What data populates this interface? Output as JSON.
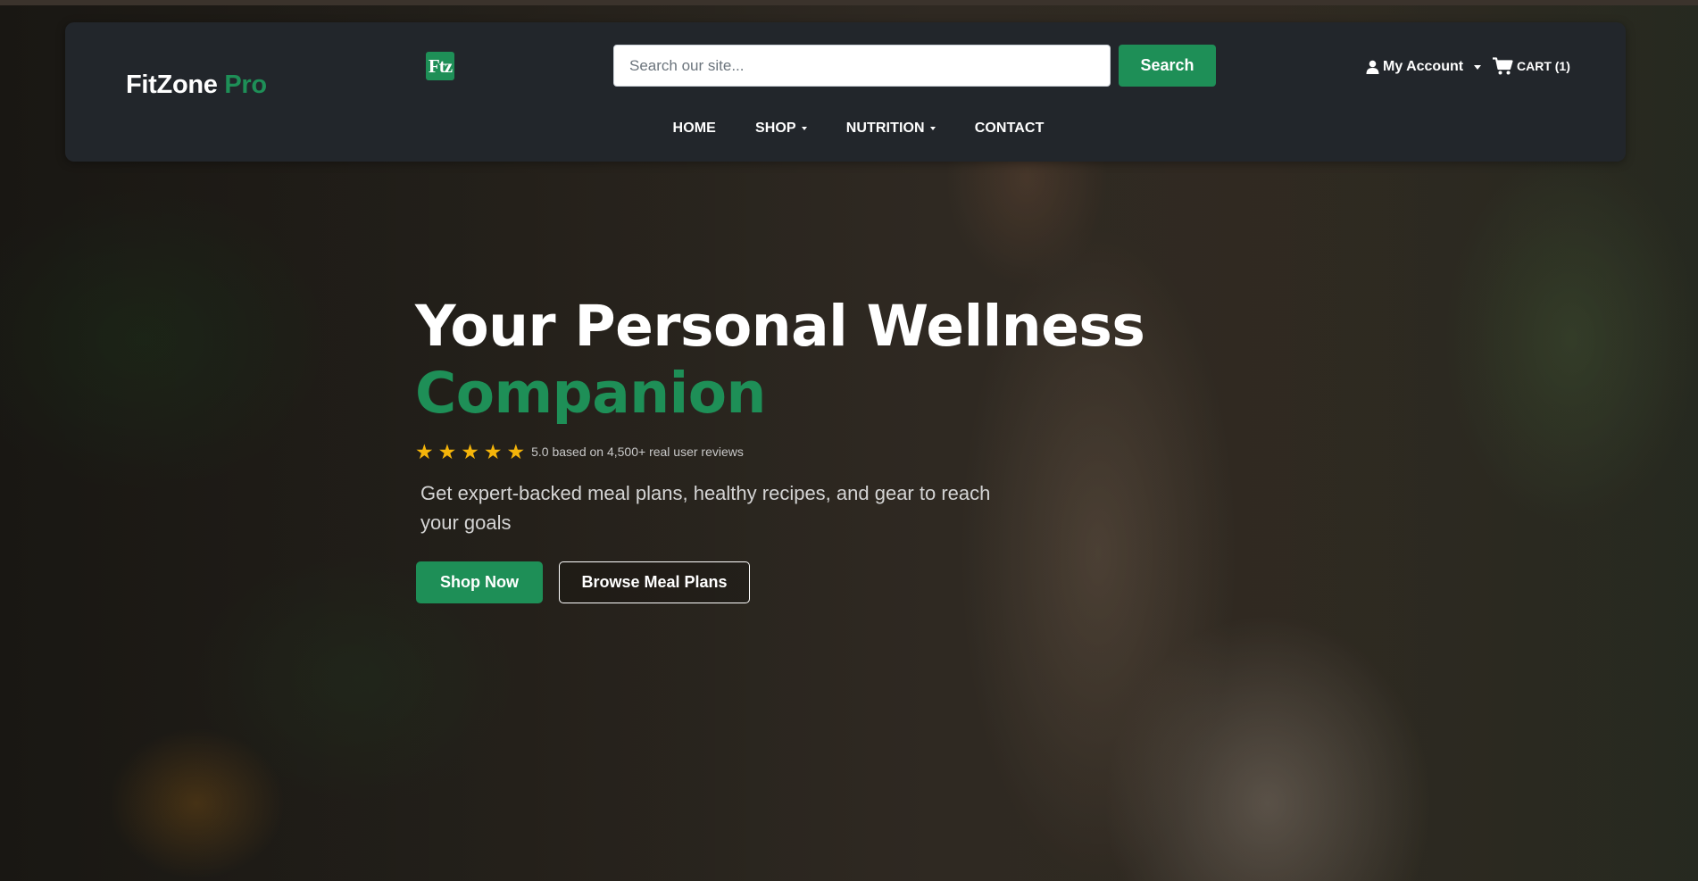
{
  "header": {
    "brand_name": "FitZone",
    "brand_suffix": "Pro",
    "logo_text": "Ftz",
    "search": {
      "placeholder": "Search our site...",
      "value": "",
      "button_label": "Search"
    },
    "account_label": "My Account",
    "cart_label": "CART (1)"
  },
  "nav": {
    "items": [
      {
        "label": "HOME",
        "has_dropdown": false
      },
      {
        "label": "SHOP",
        "has_dropdown": true
      },
      {
        "label": "NUTRITION",
        "has_dropdown": true
      },
      {
        "label": "CONTACT",
        "has_dropdown": false
      }
    ]
  },
  "hero": {
    "title_line1": "Your Personal Wellness",
    "title_line2": "Companion",
    "rating": {
      "stars": 5,
      "star_glyph": "★",
      "text": "5.0 based on 4,500+ real user reviews"
    },
    "subtitle": "Get expert-backed meal plans, healthy recipes, and gear to reach your goals",
    "primary_cta": "Shop Now",
    "secondary_cta": "Browse Meal Plans"
  },
  "colors": {
    "accent": "#1e8f57",
    "navbar_bg": "#22262b",
    "star": "#f5b50a"
  }
}
